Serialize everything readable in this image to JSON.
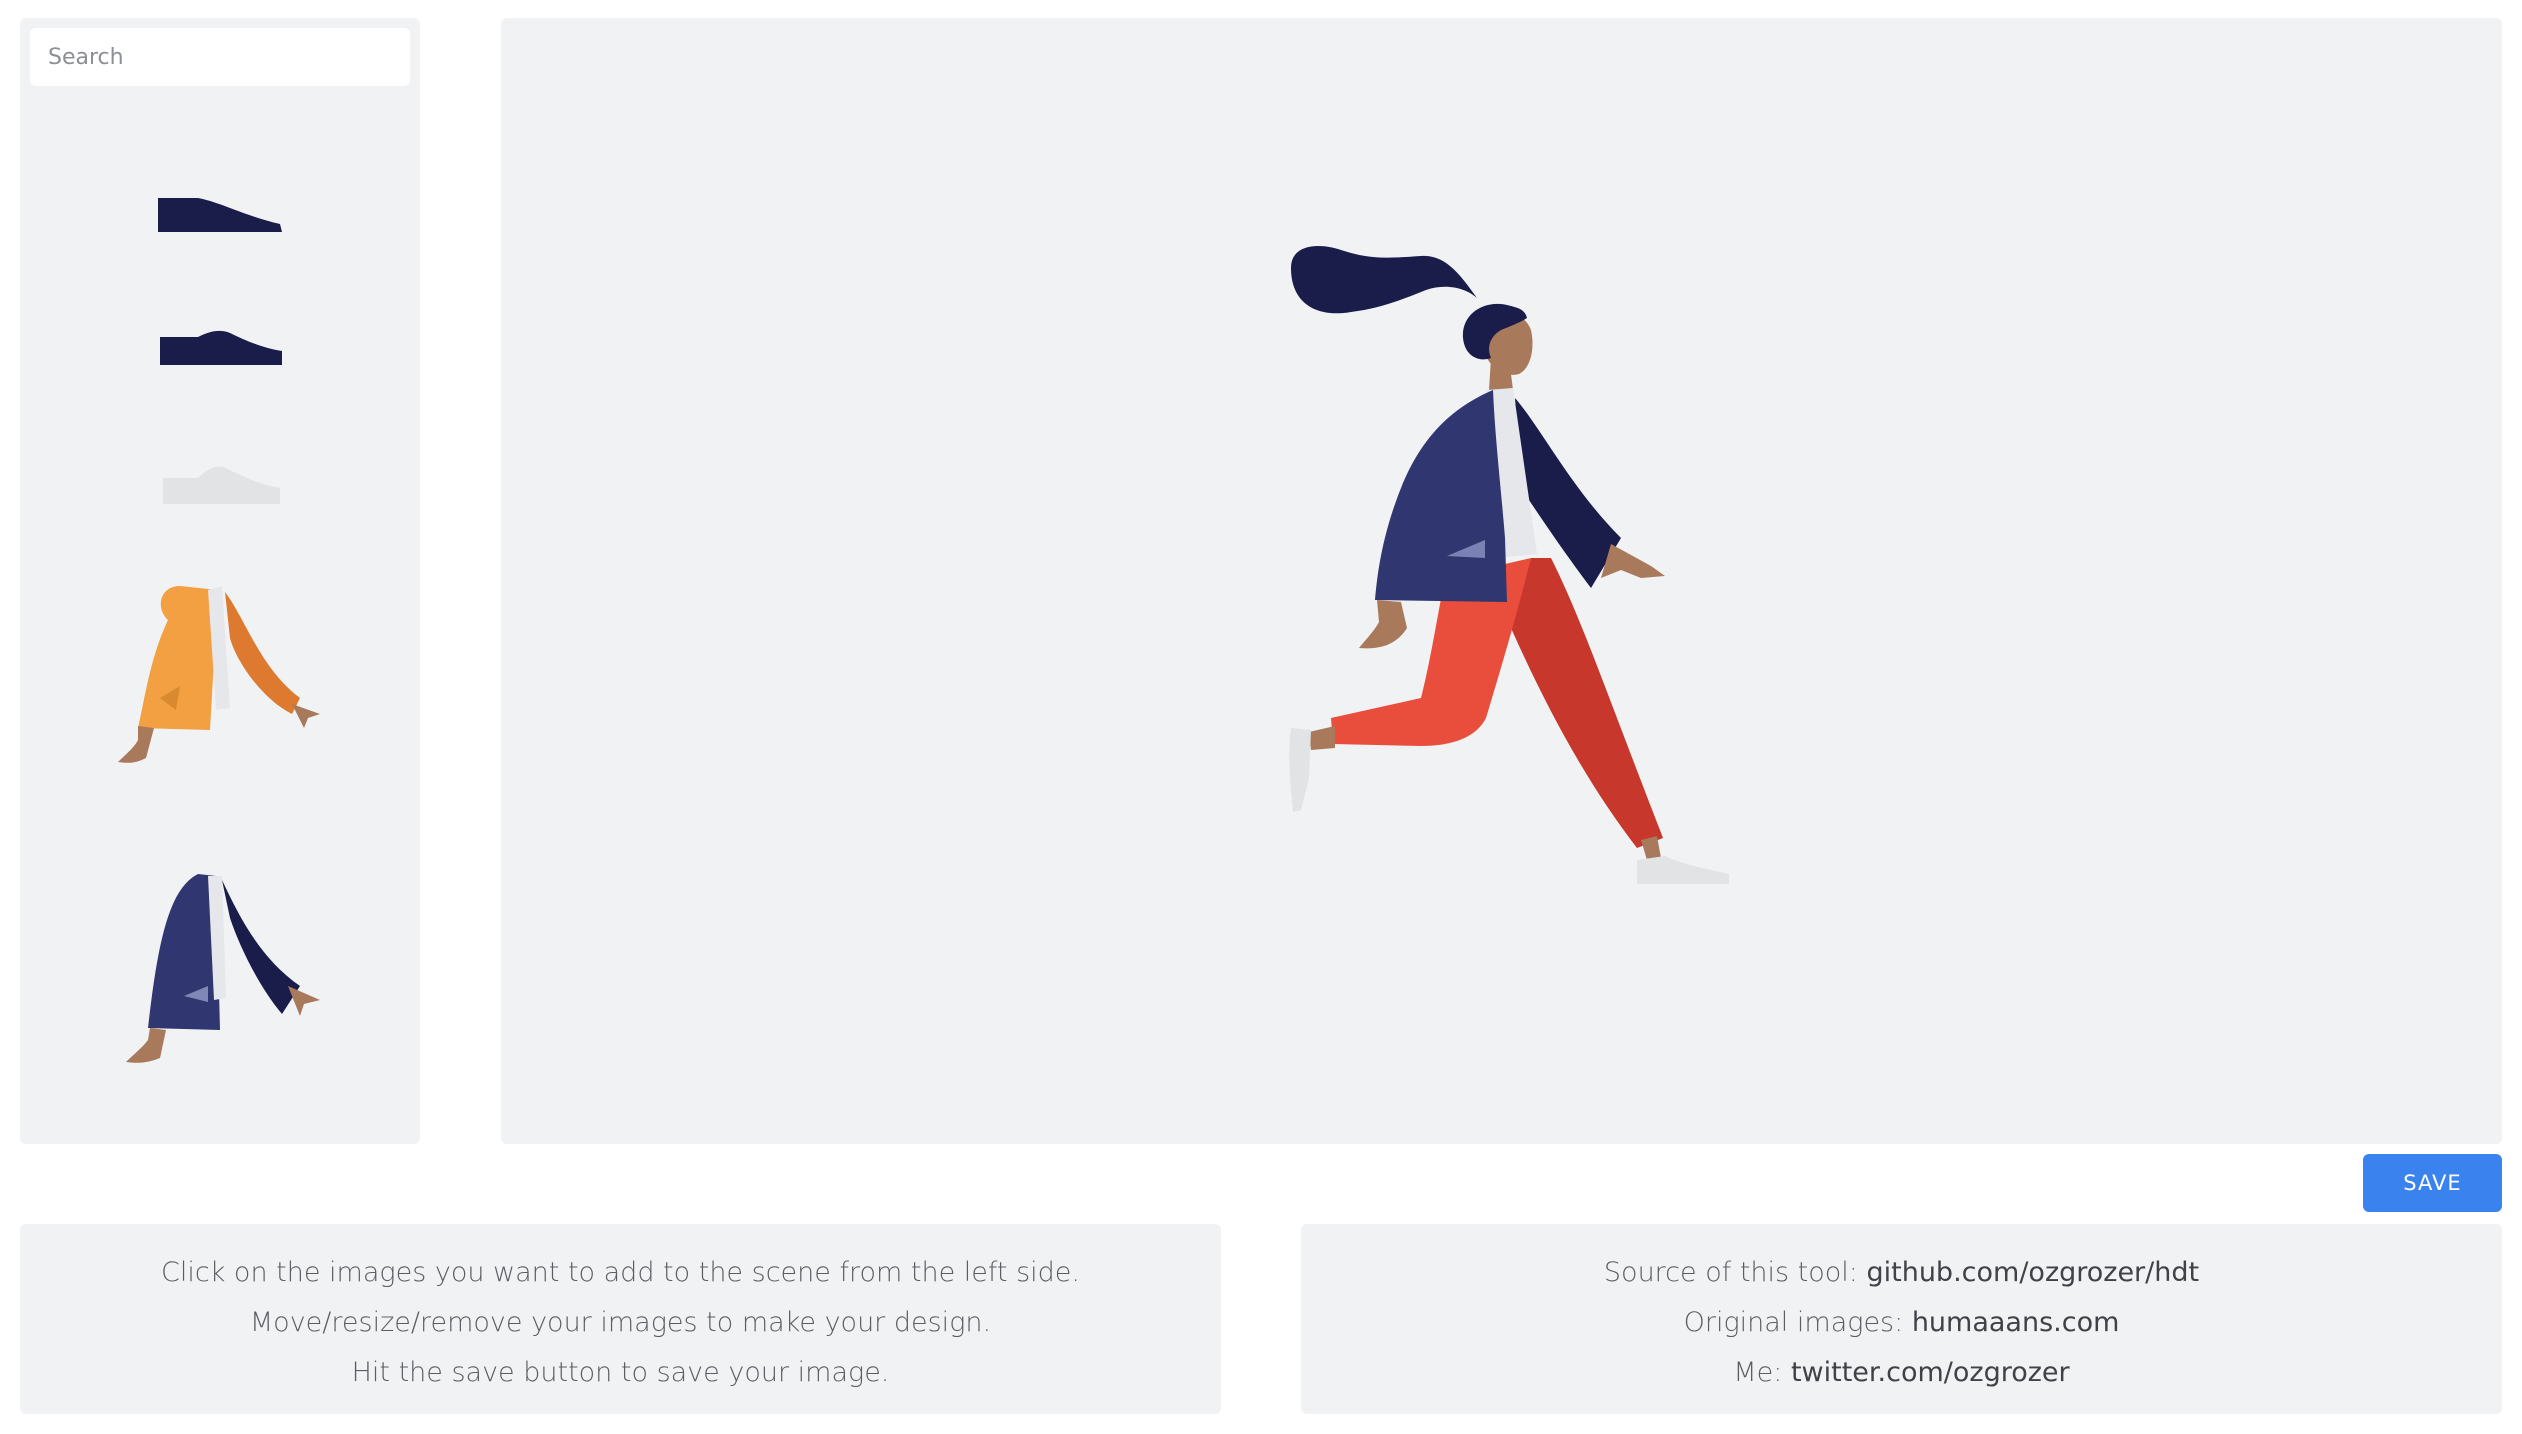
{
  "search": {
    "placeholder": "Search"
  },
  "sidebar": {
    "items": [
      {
        "name": "dark-low-shoe"
      },
      {
        "name": "dark-sneaker"
      },
      {
        "name": "light-sneaker"
      },
      {
        "name": "orange-jacket-torso"
      },
      {
        "name": "navy-jacket-torso"
      }
    ]
  },
  "toolbar": {
    "save_label": "SAVE"
  },
  "instructions": {
    "line1": "Click on the images you want to add to the scene from the left side.",
    "line2": "Move/resize/remove your images to make your design.",
    "line3": "Hit the save button to save your image."
  },
  "credits": {
    "source_label": "Source of this tool: ",
    "source_link": "github.com/ozgrozer/hdt",
    "images_label": "Original images: ",
    "images_link": "humaaans.com",
    "me_label": "Me: ",
    "me_link": "twitter.com/ozgrozer"
  },
  "colors": {
    "accent": "#3a82ee",
    "panel_bg": "#f1f2f4",
    "navy": "#1c1f4e",
    "jacket_blue": "#2f3670",
    "pants_red": "#e94e3d",
    "orange": "#f2a041",
    "skin": "#a8795b"
  }
}
